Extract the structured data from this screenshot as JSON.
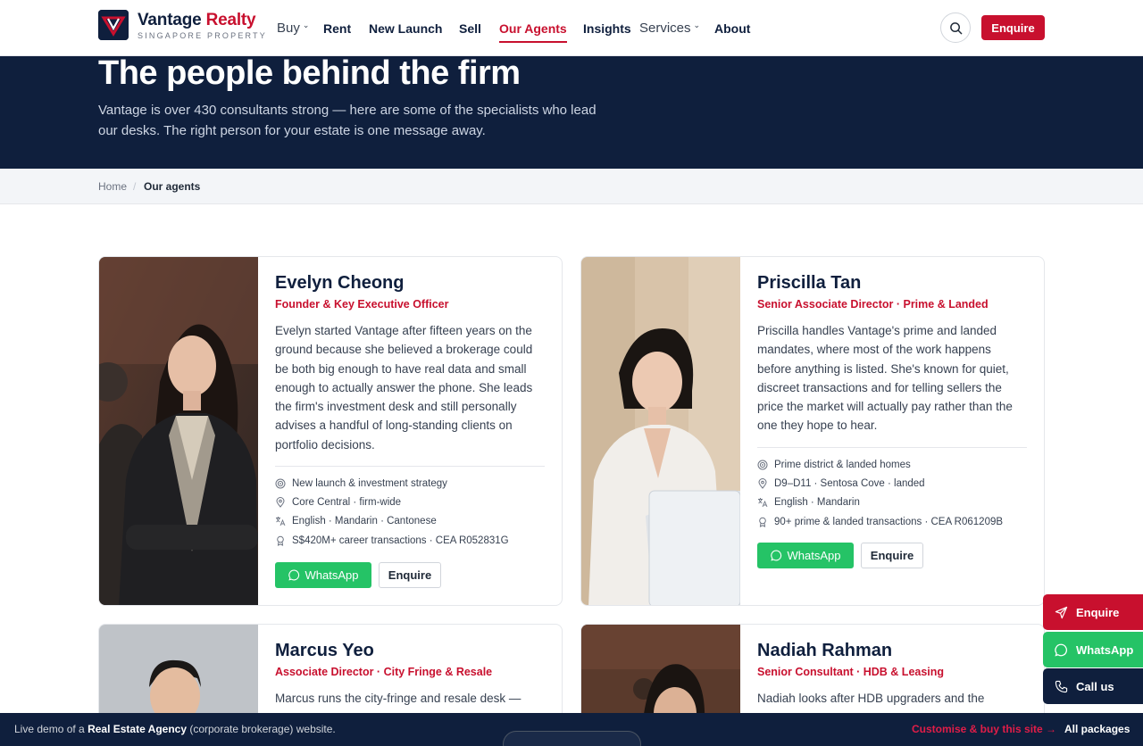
{
  "brand": {
    "name_main": "Vantage",
    "name_accent": "Realty",
    "sub": "SINGAPORE PROPERTY"
  },
  "nav": {
    "buy": "Buy",
    "rent": "Rent",
    "new_launch": "New Launch",
    "sell": "Sell",
    "agents": "Our Agents",
    "insights": "Insights",
    "services": "Services",
    "about": "About",
    "enquire": "Enquire"
  },
  "hero": {
    "title": "The people behind the firm",
    "subtitle": "Vantage is over 430 consultants strong — here are some of the specialists who lead our desks. The right person for your estate is one message away."
  },
  "breadcrumb": {
    "home": "Home",
    "sep": "/",
    "current": "Our agents"
  },
  "agents": [
    {
      "name": "Evelyn Cheong",
      "role": "Founder & Key Executive Officer",
      "bio": "Evelyn started Vantage after fifteen years on the ground because she believed a brokerage could be both big enough to have real data and small enough to actually answer the phone. She leads the firm's investment desk and still personally advises a handful of long-standing clients on portfolio decisions.",
      "specialty": "New launch & investment strategy",
      "area": "Core Central · firm-wide",
      "languages": "English · Mandarin · Cantonese",
      "record": "S$420M+ career transactions · CEA R052831G",
      "whatsapp": "WhatsApp",
      "enquire": "Enquire"
    },
    {
      "name": "Priscilla Tan",
      "role": "Senior Associate Director · Prime & Landed",
      "bio": "Priscilla handles Vantage's prime and landed mandates, where most of the work happens before anything is listed. She's known for quiet, discreet transactions and for telling sellers the price the market will actually pay rather than the one they hope to hear.",
      "specialty": "Prime district & landed homes",
      "area": "D9–D11 · Sentosa Cove · landed",
      "languages": "English · Mandarin",
      "record": "90+ prime & landed transactions · CEA R061209B",
      "whatsapp": "WhatsApp",
      "enquire": "Enquire"
    },
    {
      "name": "Marcus Yeo",
      "role": "Associate Director · City Fringe & Resale",
      "bio": "Marcus runs the city-fringe and resale desk —"
    },
    {
      "name": "Nadiah Rahman",
      "role": "Senior Consultant · HDB & Leasing",
      "bio": "Nadiah looks after HDB upgraders and the"
    }
  ],
  "float": {
    "enquire": "Enquire",
    "whatsapp": "WhatsApp",
    "call": "Call us"
  },
  "demobar": {
    "prefix": "Live demo of a ",
    "bold": "Real Estate Agency",
    "suffix": " (corporate brokerage) website.",
    "cta": "Customise & buy this site →",
    "all": "All packages"
  },
  "colors": {
    "navy": "#0f1f3d",
    "brand_red": "#c8102e",
    "whatsapp_green": "#25c366"
  }
}
